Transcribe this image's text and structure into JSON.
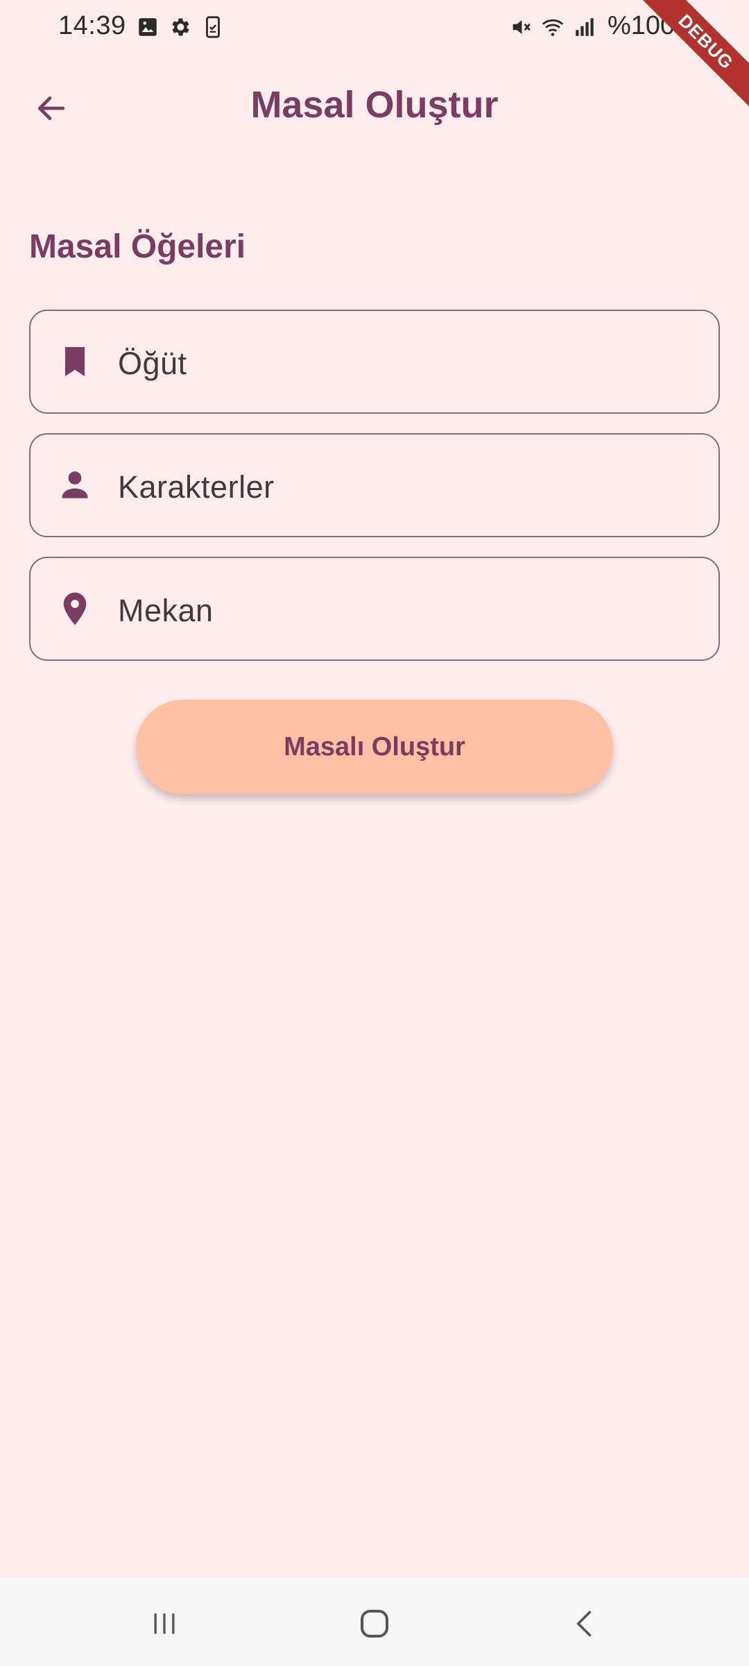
{
  "status_bar": {
    "time": "14:39",
    "battery_text": "%100",
    "left_icons": [
      "image-icon",
      "gear-icon",
      "device-clipboard-icon"
    ],
    "right_icons": [
      "mute-icon",
      "wifi-icon",
      "signal-icon",
      "battery-icon"
    ]
  },
  "debug_banner": "DEBUG",
  "app_bar": {
    "title": "Masal Oluştur",
    "back_icon": "arrow-left-icon"
  },
  "section": {
    "title": "Masal Öğeleri"
  },
  "fields": [
    {
      "label": "Öğüt",
      "icon": "bookmark-icon"
    },
    {
      "label": "Karakterler",
      "icon": "person-icon"
    },
    {
      "label": "Mekan",
      "icon": "location-pin-icon"
    }
  ],
  "submit_button": {
    "label": "Masalı Oluştur"
  },
  "nav_bar": {
    "icons": [
      "recent-apps-icon",
      "home-icon",
      "back-icon"
    ]
  },
  "colors": {
    "background": "#FFEDEE",
    "primary": "#7A3D62",
    "button": "#FFC0A4",
    "outline": "#7B7178",
    "text": "#3F3A3E"
  }
}
